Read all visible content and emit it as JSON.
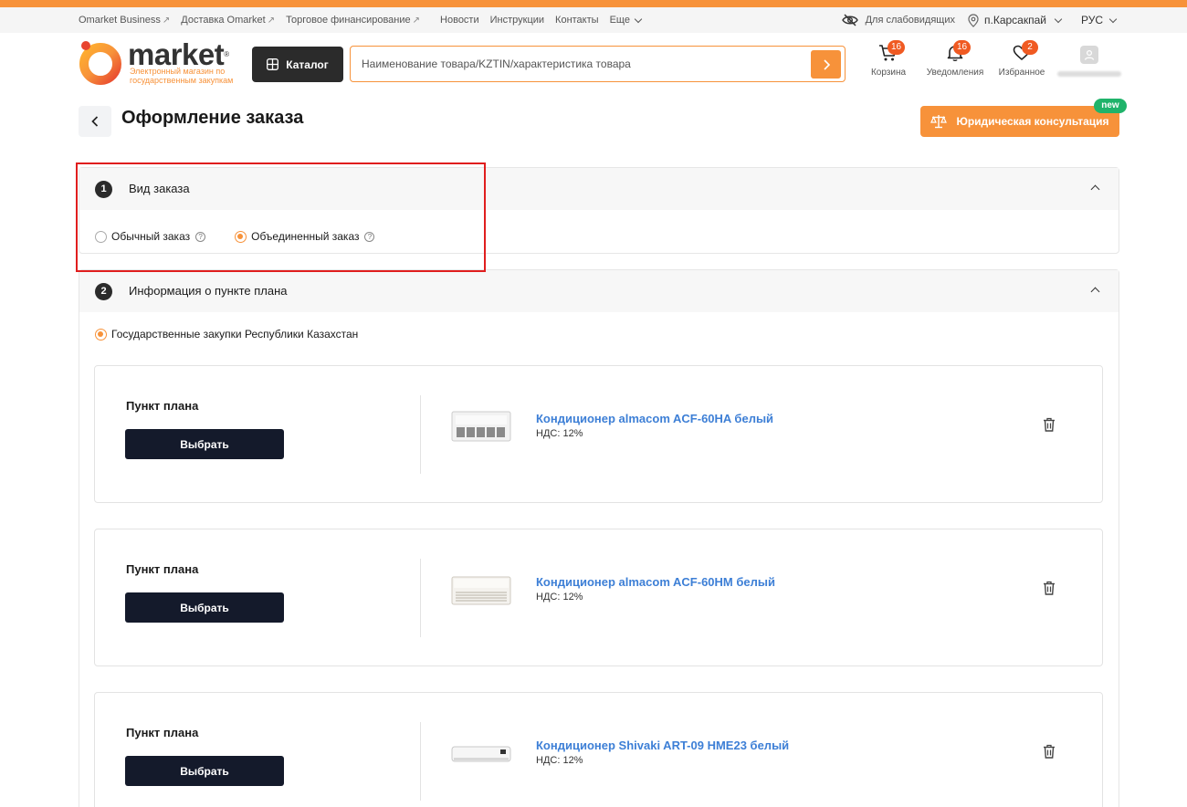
{
  "topbar": {
    "links": [
      {
        "label": "Omarket Business",
        "ext": "↗"
      },
      {
        "label": "Доставка Omarket",
        "ext": "↗"
      },
      {
        "label": "Торговое финансирование",
        "ext": "↗"
      },
      {
        "label": "Новости",
        "ext": ""
      },
      {
        "label": "Инструкции",
        "ext": ""
      },
      {
        "label": "Контакты",
        "ext": ""
      },
      {
        "label": "Еще",
        "ext": ""
      }
    ],
    "accessibility": "Для слабовидящих",
    "city": "п.Карсакпай",
    "language": "РУС"
  },
  "logo": {
    "name": "market",
    "tagline_line1": "Электронный магазин по",
    "tagline_line2": "государственным закупкам"
  },
  "header": {
    "catalog_label": "Каталог",
    "search_placeholder": "Наименование товара/KZTIN/характеристика товара",
    "cart": {
      "label": "Корзина",
      "count": "16"
    },
    "notifications": {
      "label": "Уведомления",
      "count": "16"
    },
    "favorites": {
      "label": "Избранное",
      "count": "2"
    }
  },
  "page": {
    "title": "Оформление заказа",
    "legal_button": "Юридическая консультация",
    "new_badge": "new"
  },
  "section1": {
    "number": "1",
    "title": "Вид заказа",
    "options": [
      {
        "label": "Обычный заказ",
        "selected": false
      },
      {
        "label": "Объединенный заказ",
        "selected": true
      }
    ]
  },
  "section2": {
    "number": "2",
    "title": "Информация о пункте плана",
    "procurement_type": "Государственные закупки Республики Казахстан",
    "items": [
      {
        "plan_label": "Пункт плана",
        "button": "Выбрать",
        "product": "Кондиционер almacom ACF-60HA белый",
        "vat": "НДС: 12%"
      },
      {
        "plan_label": "Пункт плана",
        "button": "Выбрать",
        "product": "Кондиционер almacom ACF-60HM белый",
        "vat": "НДС: 12%"
      },
      {
        "plan_label": "Пункт плана",
        "button": "Выбрать",
        "product": "Кондиционер Shivaki ART-09 HME23 белый",
        "vat": "НДС: 12%"
      }
    ]
  },
  "colors": {
    "accent": "#f7923a",
    "dark": "#141a2b",
    "link": "#3d7fd6",
    "highlight": "#e01e1e",
    "badge": "#f05a22",
    "new": "#1fb36a"
  }
}
